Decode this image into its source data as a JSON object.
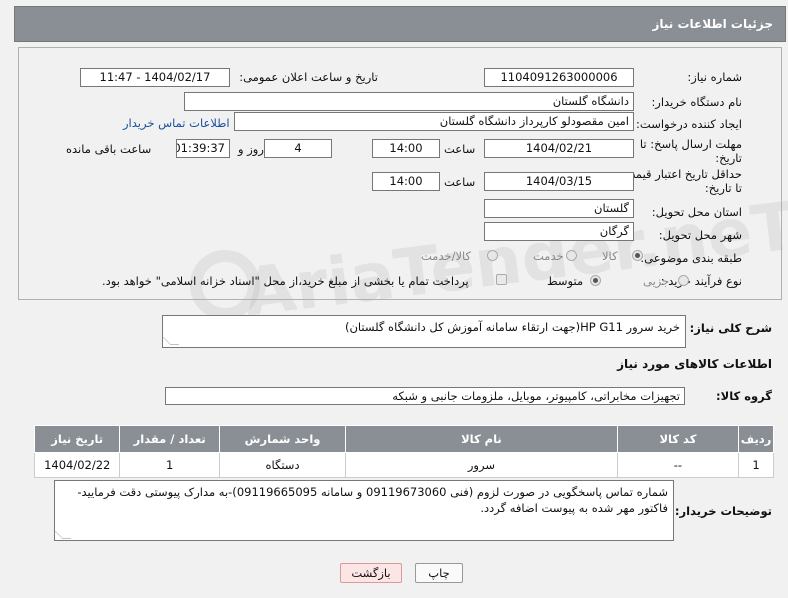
{
  "header": {
    "title": "جزئیات اطلاعات نیاز"
  },
  "fields": {
    "need_number_label": "شماره نیاز:",
    "need_number": "1104091263000006",
    "announce_label": "تاریخ و ساعت اعلان عمومی:",
    "announce_value": "1404/02/17 - 11:47",
    "buyer_org_label": "نام دستگاه خریدار:",
    "buyer_org": "دانشگاه گلستان",
    "creator_label": "ایجاد کننده درخواست:",
    "creator": "امین مقصودلو کارپرداز دانشگاه گلستان",
    "contact_link": "اطلاعات تماس خریدار",
    "deadline_label_1": "مهلت ارسال پاسخ: تا",
    "deadline_label_2": "تاریخ:",
    "deadline_date": "1404/02/21",
    "hour_label": "ساعت",
    "deadline_time": "14:00",
    "days_value": "4",
    "days_label": "روز و",
    "remaining_time": "01:39:37",
    "remaining_label": "ساعت باقی مانده",
    "min_validity_label_1": "حداقل تاریخ اعتبار قیمت:",
    "min_validity_label_2": "تا تاریخ:",
    "validity_date": "1404/03/15",
    "validity_hour_label": "ساعت",
    "validity_time": "14:00",
    "province_label": "استان محل تحویل:",
    "province": "گلستان",
    "city_label": "شهر محل تحویل:",
    "city": "گرگان",
    "category_label": "طبقه بندی موضوعی:",
    "category_options": [
      "کالا",
      "خدمت",
      "کالا/خدمت"
    ],
    "process_label": "نوع فرآیند خرید :",
    "process_options": [
      "جزیی",
      "متوسط"
    ],
    "payment_note": "پرداخت تمام یا بخشی از مبلغ خرید،از محل \"اسناد خزانه اسلامی\" خواهد بود."
  },
  "description": {
    "label": "شرح کلی نیاز:",
    "value": "خرید سرور HP G11(جهت ارتقاء سامانه آموزش کل دانشگاه گلستان)"
  },
  "goods_info_title": "اطلاعات کالاهای مورد نیاز",
  "goods_group": {
    "label": "گروه کالا:",
    "value": "تجهیزات مخابراتی، کامپیوتر، موبایل، ملزومات جانبی و شبکه"
  },
  "table": {
    "headers": [
      "ردیف",
      "کد کالا",
      "نام کالا",
      "واحد شمارش",
      "تعداد / مقدار",
      "تاریخ نیاز"
    ],
    "rows": [
      [
        "1",
        "--",
        "سرور",
        "دستگاه",
        "1",
        "1404/02/22"
      ]
    ]
  },
  "buyer_notes": {
    "label": "توضیحات خریدار:",
    "value": "شماره تماس پاسخگویی در صورت لزوم (فنی 09119673060 و سامانه 09119665095)-به مدارک پیوستی دقت فرمایید-فاکتور مهر شده به پیوست اضافه گردد."
  },
  "buttons": {
    "print": "چاپ",
    "back": "بازگشت"
  },
  "watermark": "AriaTender.neT"
}
